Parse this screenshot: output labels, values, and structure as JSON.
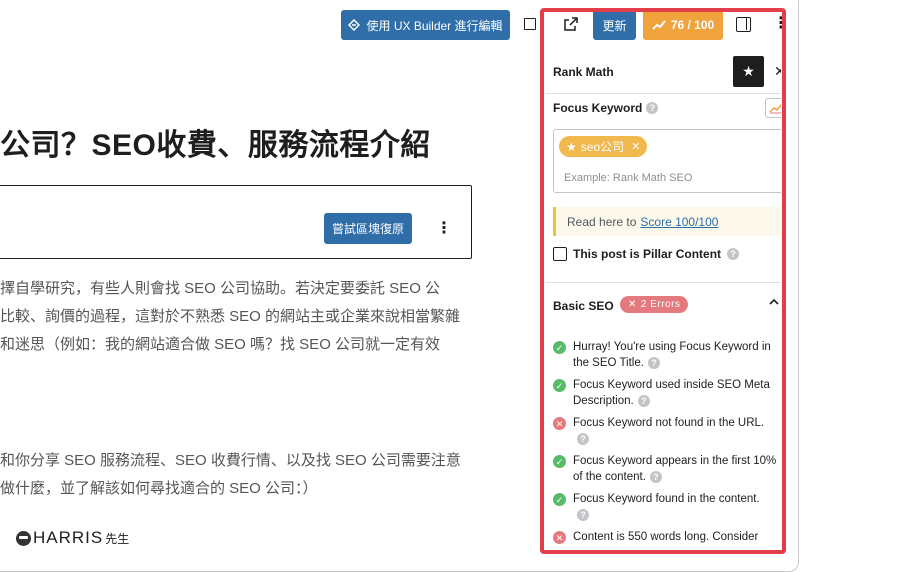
{
  "topbar": {
    "ux_builder_label": "使用 UX Builder 進行編輯",
    "update_label": "更新",
    "score_label": "76 / 100"
  },
  "editor": {
    "title": "公司？SEO收費、服務流程介紹",
    "restore_label": "嘗試區塊復原",
    "para1": [
      "擇自學研究，有些人則會找 SEO 公司協助。若決定要委託 SEO 公",
      "比較、詢價的過程，這對於不熟悉 SEO 的網站主或企業來說相當繁雜",
      "和迷思（例如：我的網站適合做 SEO 嗎？找 SEO 公司就一定有效"
    ],
    "para2": [
      "和你分享 SEO 服務流程、SEO 收費行情、以及找 SEO 公司需要注意",
      "做什麼，並了解該如何尋找適合的 SEO 公司：）"
    ],
    "logo_text": "HARRIS",
    "logo_suffix": "先生"
  },
  "sidebar": {
    "title": "Rank Math",
    "focus_keyword_label": "Focus Keyword",
    "keyword_tag": "seo公司",
    "keyword_placeholder": "Example: Rank Math SEO",
    "read_here": "Read here to",
    "read_here_link": "Score 100/100",
    "pillar_label": "This post is Pillar Content",
    "basic_seo_label": "Basic SEO",
    "errors_badge": "2 Errors",
    "checks": [
      {
        "status": "ok",
        "text": "Hurray! You're using Focus Keyword in the SEO Title."
      },
      {
        "status": "ok",
        "text": "Focus Keyword used inside SEO Meta Description."
      },
      {
        "status": "bad",
        "text": "Focus Keyword not found in the URL."
      },
      {
        "status": "ok",
        "text": "Focus Keyword appears in the first 10% of the content."
      },
      {
        "status": "ok",
        "text": "Focus Keyword found in the content."
      },
      {
        "status": "bad",
        "text": "Content is 550 words long. Consider"
      }
    ]
  },
  "colors": {
    "primary_blue": "#2f6ea9",
    "score_orange": "#f0a33c",
    "highlight_red": "#e33d4a",
    "ok_green": "#58bb6a",
    "error_red": "#e47a7e"
  }
}
